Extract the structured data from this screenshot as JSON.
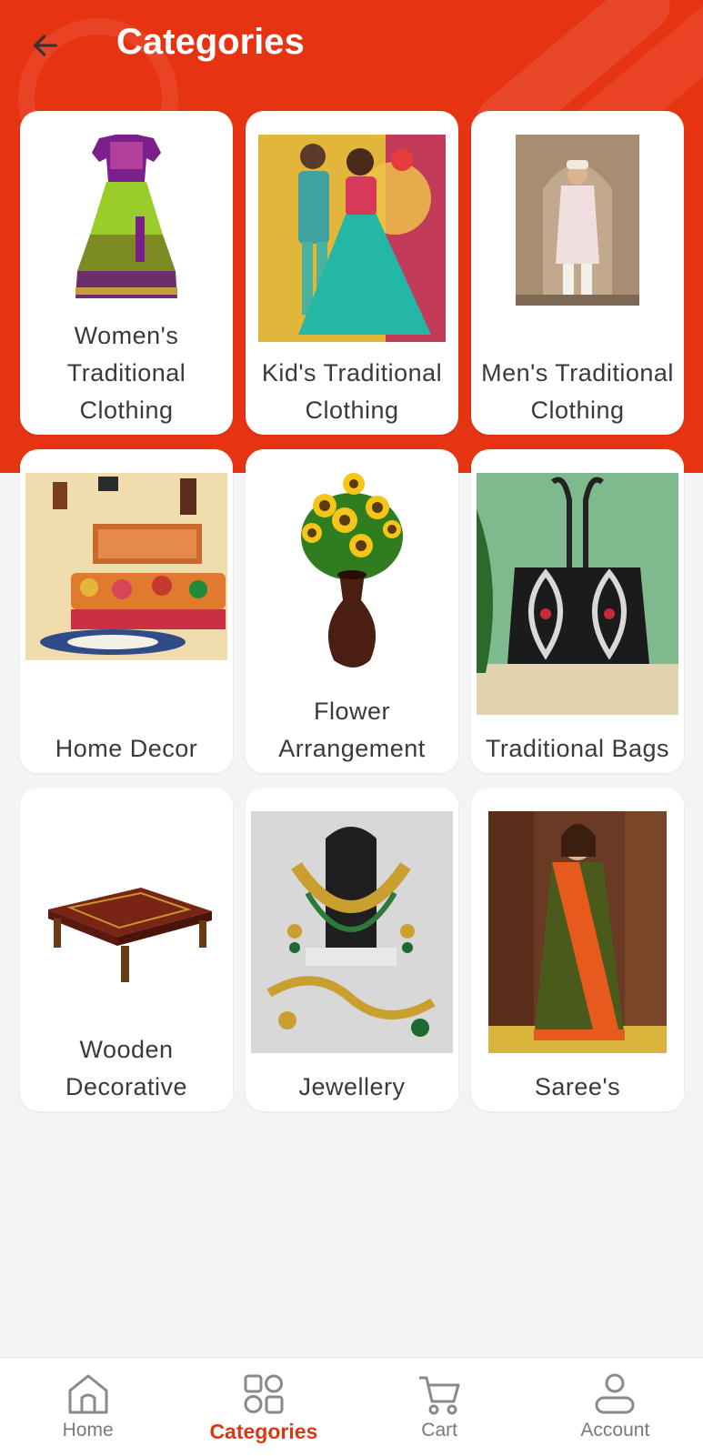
{
  "header": {
    "title": "Categories",
    "color": "#e63312"
  },
  "categories": [
    {
      "label": "Women's Traditional Clothing",
      "image": "girl-lehenga-dress"
    },
    {
      "label": "Kid's Traditional Clothing",
      "image": "kids-ethnic-wear-photo"
    },
    {
      "label": "Men's Traditional Clothing",
      "image": "men-sherwani-photo"
    },
    {
      "label": "Home Decor",
      "image": "living-room-decor-photo"
    },
    {
      "label": "Flower Arrangement",
      "image": "sunflowers-vase"
    },
    {
      "label": "Traditional Bags",
      "image": "embroidered-tote-bag"
    },
    {
      "label": "Wooden Decorative",
      "image": "wooden-low-table"
    },
    {
      "label": "Jewellery",
      "image": "bridal-jewellery-set"
    },
    {
      "label": "Saree's",
      "image": "saree-model-photo"
    }
  ],
  "nav": {
    "active": "Categories",
    "active_color": "#d83a16",
    "items": [
      {
        "label": "Home",
        "icon": "home-icon"
      },
      {
        "label": "Categories",
        "icon": "categories-icon"
      },
      {
        "label": "Cart",
        "icon": "cart-icon"
      },
      {
        "label": "Account",
        "icon": "account-icon"
      }
    ]
  }
}
